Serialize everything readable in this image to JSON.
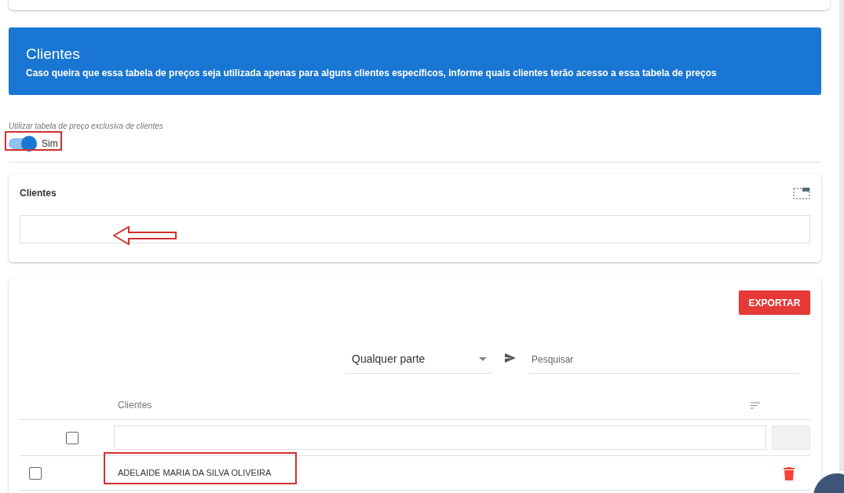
{
  "banner": {
    "title": "Clientes",
    "subtitle": "Caso queira que essa tabela de preços seja utilizada apenas para alguns clientes específicos, informe quais clientes terão acesso a essa tabela de preços"
  },
  "exclusive_toggle": {
    "label": "Utilizar tabela de preço exclusiva de clientes",
    "on": true,
    "state_text": "Sim"
  },
  "clients_card": {
    "title": "Clientes"
  },
  "table": {
    "export_button": "EXPORTAR",
    "match_select": "Qualquer parte",
    "search": {
      "placeholder": "Pesquisar"
    },
    "columns": [
      "Clientes"
    ],
    "select_all": {
      "checked": false
    },
    "rows": [
      {
        "name": "ADELAIDE MARIA DA SILVA OLIVEIRA",
        "checked": false
      }
    ]
  }
}
